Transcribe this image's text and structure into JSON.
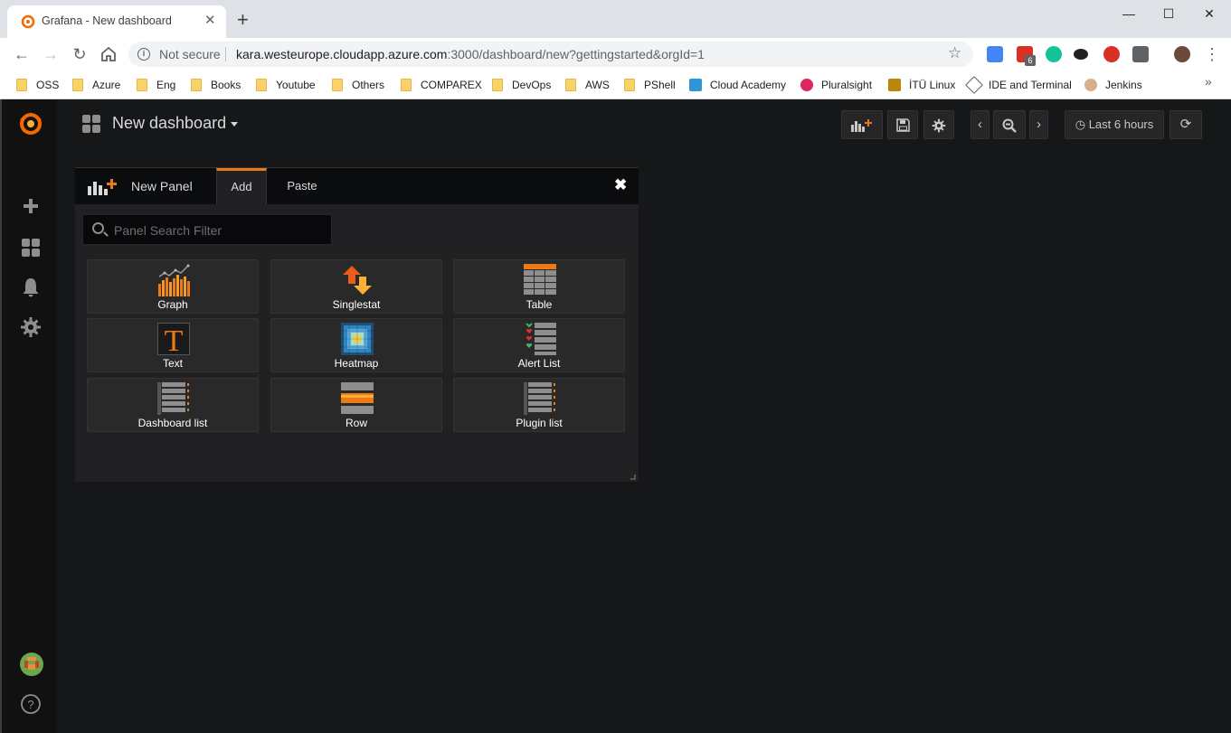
{
  "browser": {
    "tab_title": "Grafana - New dashboard",
    "new_tab_label": "+",
    "window": {
      "minimize": "—",
      "maximize": "☐",
      "close": "✕"
    },
    "address": {
      "security_label": "Not secure",
      "url_host": "kara.westeurope.cloudapp.azure.com",
      "url_rest": ":3000/dashboard/new?gettingstarted&orgId=1"
    },
    "extension_badge": "6",
    "bookmarks": [
      {
        "label": "OSS",
        "icon": "folder-icon"
      },
      {
        "label": "Azure",
        "icon": "folder-icon"
      },
      {
        "label": "Eng",
        "icon": "folder-icon"
      },
      {
        "label": "Books",
        "icon": "folder-icon"
      },
      {
        "label": "Youtube",
        "icon": "folder-icon"
      },
      {
        "label": "Others",
        "icon": "folder-icon"
      },
      {
        "label": "COMPAREX",
        "icon": "folder-icon"
      },
      {
        "label": "DevOps",
        "icon": "folder-icon"
      },
      {
        "label": "AWS",
        "icon": "folder-icon"
      },
      {
        "label": "PShell",
        "icon": "folder-icon"
      },
      {
        "label": "Cloud Academy",
        "icon": "cloud-academy-icon"
      },
      {
        "label": "Pluralsight",
        "icon": "pluralsight-icon"
      },
      {
        "label": "İTÜ Linux",
        "icon": "itu-icon"
      },
      {
        "label": "IDE and Terminal",
        "icon": "ide-icon"
      },
      {
        "label": "Jenkins",
        "icon": "jenkins-icon"
      }
    ],
    "bookmarks_overflow": "»"
  },
  "grafana": {
    "dashboard_title": "New dashboard",
    "timepicker_label": "Last 6 hours",
    "add_panel": {
      "header_title": "New Panel",
      "tabs": [
        "Add",
        "Paste"
      ],
      "active_tab": "Add",
      "close_glyph": "✖",
      "search_placeholder": "Panel Search Filter",
      "panels": [
        {
          "label": "Graph",
          "icon": "graph-icon"
        },
        {
          "label": "Singlestat",
          "icon": "singlestat-icon"
        },
        {
          "label": "Table",
          "icon": "table-icon"
        },
        {
          "label": "Text",
          "icon": "text-icon"
        },
        {
          "label": "Heatmap",
          "icon": "heatmap-icon"
        },
        {
          "label": "Alert List",
          "icon": "alert-list-icon"
        },
        {
          "label": "Dashboard list",
          "icon": "dashboard-list-icon"
        },
        {
          "label": "Row",
          "icon": "row-icon"
        },
        {
          "label": "Plugin list",
          "icon": "plugin-list-icon"
        }
      ]
    },
    "colors": {
      "accent": "#eb7b18",
      "background": "#161719",
      "panel_bg": "#212124",
      "sidemenu_bg": "#111111"
    }
  }
}
